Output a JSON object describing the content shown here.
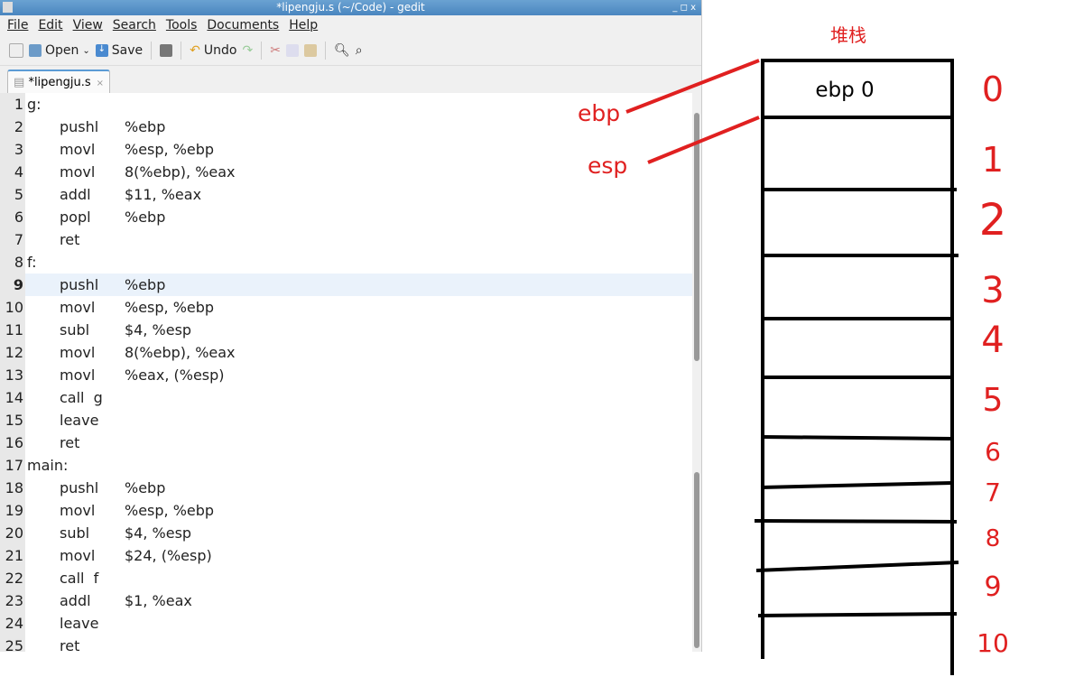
{
  "window": {
    "title": "*lipengju.s (~/Code) - gedit",
    "controls": "_ ◻ x"
  },
  "menu": [
    "File",
    "Edit",
    "View",
    "Search",
    "Tools",
    "Documents",
    "Help"
  ],
  "toolbar": {
    "open": "Open",
    "save": "Save",
    "undo": "Undo"
  },
  "tab": {
    "label": "*lipengju.s",
    "close": "×"
  },
  "editor": {
    "current_line": 9,
    "lines": [
      [
        "g:",
        "",
        ""
      ],
      [
        "",
        "pushl",
        "%ebp"
      ],
      [
        "",
        "movl",
        "%esp, %ebp"
      ],
      [
        "",
        "movl",
        "8(%ebp), %eax"
      ],
      [
        "",
        "addl",
        "$11, %eax"
      ],
      [
        "",
        "popl",
        "%ebp"
      ],
      [
        "",
        "ret",
        ""
      ],
      [
        "f:",
        "",
        ""
      ],
      [
        "",
        "pushl",
        "%ebp"
      ],
      [
        "",
        "movl",
        "%esp, %ebp"
      ],
      [
        "",
        "subl",
        "$4, %esp"
      ],
      [
        "",
        "movl",
        "8(%ebp), %eax"
      ],
      [
        "",
        "movl",
        "%eax, (%esp)"
      ],
      [
        "",
        "call  g",
        ""
      ],
      [
        "",
        "leave",
        ""
      ],
      [
        "",
        "ret",
        ""
      ],
      [
        "main:",
        "",
        ""
      ],
      [
        "",
        "pushl",
        "%ebp"
      ],
      [
        "",
        "movl",
        "%esp, %ebp"
      ],
      [
        "",
        "subl",
        "$4, %esp"
      ],
      [
        "",
        "movl",
        "$24, (%esp)"
      ],
      [
        "",
        "call  f",
        ""
      ],
      [
        "",
        "addl",
        "$1, %eax"
      ],
      [
        "",
        "leave",
        ""
      ],
      [
        "",
        "ret",
        ""
      ]
    ]
  },
  "diagram": {
    "title": "堆栈",
    "cell0": "ebp 0",
    "pointer_labels": [
      "ebp",
      "esp"
    ],
    "indices": [
      "0",
      "1",
      "2",
      "3",
      "4",
      "5",
      "6",
      "7",
      "8",
      "9",
      "10"
    ],
    "accent": "#e02020"
  }
}
